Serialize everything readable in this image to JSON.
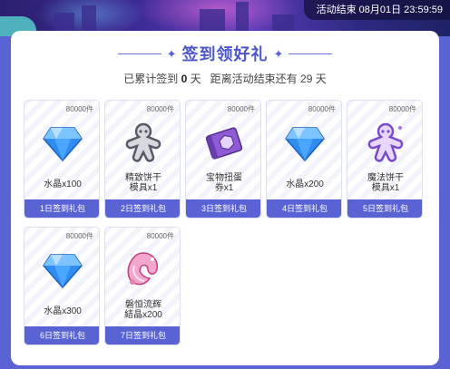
{
  "header": {
    "end_time": "活动结束 08月01日 23:59:59"
  },
  "title": "签到领好礼",
  "progress": {
    "prefix": "已累计签到",
    "days_signed": "0",
    "middle": "天   距离活动结束还有",
    "days_left": "29",
    "suffix": "天"
  },
  "rewards": [
    {
      "count": "80000件",
      "name_line1": "水晶x100",
      "name_line2": "",
      "footer": "1日签到礼包",
      "icon": "crystal-icon"
    },
    {
      "count": "80000件",
      "name_line1": "精致饼干",
      "name_line2": "模具x1",
      "footer": "2日签到礼包",
      "icon": "cookie-mold-icon"
    },
    {
      "count": "80000件",
      "name_line1": "宝物扭蛋",
      "name_line2": "券x1",
      "footer": "3日签到礼包",
      "icon": "gacha-ticket-icon"
    },
    {
      "count": "80000件",
      "name_line1": "水晶x200",
      "name_line2": "",
      "footer": "4日签到礼包",
      "icon": "crystal-icon"
    },
    {
      "count": "80000件",
      "name_line1": "魔法饼干",
      "name_line2": "模具x1",
      "footer": "5日签到礼包",
      "icon": "magic-cookie-mold-icon"
    },
    {
      "count": "80000件",
      "name_line1": "水晶x300",
      "name_line2": "",
      "footer": "6日签到礼包",
      "icon": "crystal-icon"
    },
    {
      "count": "80000件",
      "name_line1": "磐恒流辉",
      "name_line2": "結晶x200",
      "footer": "7日签到礼包",
      "icon": "radiant-crystal-icon"
    }
  ],
  "colors": {
    "accent": "#5a63d4",
    "title": "#4d56c8",
    "crystal": "#2f8cf0",
    "book": "#8e5ad6",
    "magic": "#a57ae0",
    "pink": "#ea7fb3"
  }
}
